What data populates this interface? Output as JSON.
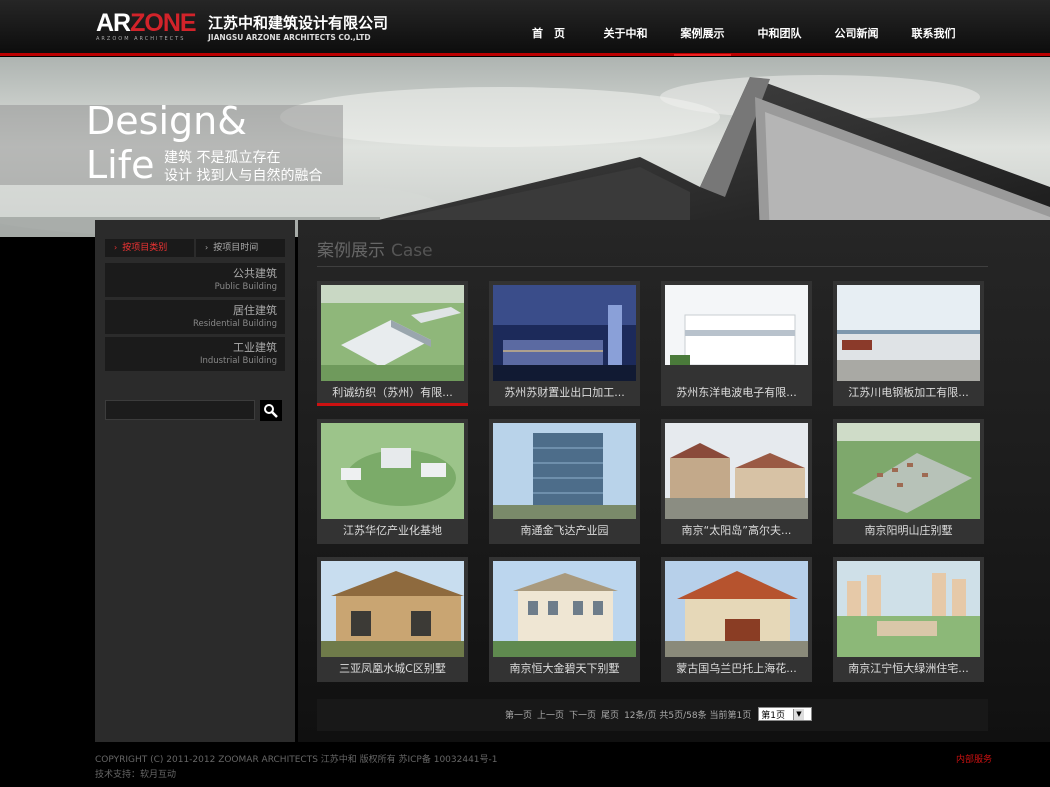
{
  "header": {
    "logo_ar": "AR",
    "logo_zone": "ZONE",
    "logo_sub": "ARZOOM ARCHITECTS",
    "company_cn": "江苏中和建筑设计有限公司",
    "company_en": "JIANGSU ARZONE ARCHITECTS CO.,LTD",
    "nav": [
      {
        "label": "首　页"
      },
      {
        "label": "关于中和"
      },
      {
        "label": "案例展示"
      },
      {
        "label": "中和团队"
      },
      {
        "label": "公司新闻"
      },
      {
        "label": "联系我们"
      }
    ],
    "active_index": 2
  },
  "banner": {
    "design": "Design&",
    "life": "Life",
    "line1": "建筑 不是孤立存在",
    "line2": "设计 找到人与自然的融合"
  },
  "sidebar": {
    "tab_category": "按项目类别",
    "tab_time": "按项目时间",
    "categories": [
      {
        "cn": "公共建筑",
        "en": "Public Building"
      },
      {
        "cn": "居住建筑",
        "en": "Residential Building"
      },
      {
        "cn": "工业建筑",
        "en": "Industrial Building"
      }
    ],
    "search_value": ""
  },
  "main": {
    "title_cn": "案例展示",
    "title_en": "Case",
    "cases": [
      {
        "caption": "利诚纺织（苏州）有限..."
      },
      {
        "caption": "苏州苏财置业出口加工..."
      },
      {
        "caption": "苏州东洋电波电子有限..."
      },
      {
        "caption": "江苏川电钢板加工有限..."
      },
      {
        "caption": "江苏华亿产业化基地"
      },
      {
        "caption": "南通金飞达产业园"
      },
      {
        "caption": "南京“太阳岛”高尔夫..."
      },
      {
        "caption": "南京阳明山庄别墅"
      },
      {
        "caption": "三亚凤凰水城C区别墅"
      },
      {
        "caption": "南京恒大金碧天下别墅"
      },
      {
        "caption": "蒙古国乌兰巴托上海花..."
      },
      {
        "caption": "南京江宁恒大绿洲住宅..."
      }
    ],
    "pager": {
      "first": "第一页",
      "prev": "上一页",
      "next": "下一页",
      "last": "尾页",
      "info": "12条/页 共5页/58条 当前第1页",
      "select_value": "第1页"
    }
  },
  "footer": {
    "copyright": "COPYRIGHT (C) 2011-2012 ZOOMAR ARCHITECTS 江苏中和 版权所有 苏ICP备 10032441号-1",
    "support": "技术支持：软月互动",
    "internal": "内部服务"
  },
  "colors": {
    "accent": "#cc1111",
    "background": "#000000"
  }
}
